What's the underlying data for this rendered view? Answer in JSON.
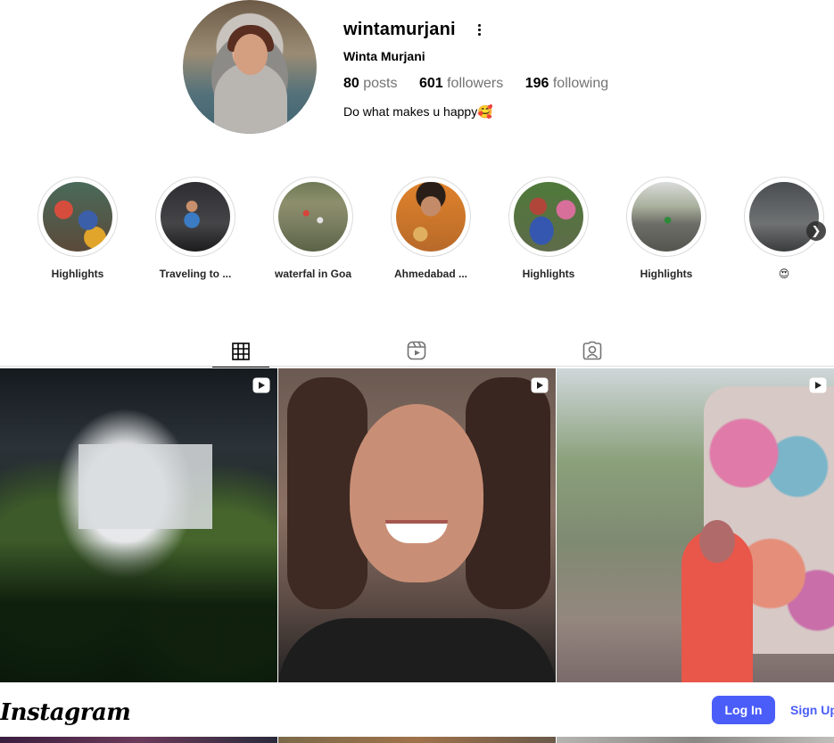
{
  "profile": {
    "username": "wintamurjani",
    "full_name": "Winta Murjani",
    "posts_count": "80",
    "posts_label": "posts",
    "followers_count": "601",
    "followers_label": "followers",
    "following_count": "196",
    "following_label": "following",
    "bio": "Do what makes u happy🥰"
  },
  "highlights": [
    {
      "label": "Highlights"
    },
    {
      "label": "Traveling to ..."
    },
    {
      "label": "waterfal in Goa"
    },
    {
      "label": "Ahmedabad ..."
    },
    {
      "label": "Highlights"
    },
    {
      "label": "Highlights"
    },
    {
      "label": "😍"
    }
  ],
  "tabs": [
    {
      "name": "posts",
      "icon": "grid-icon",
      "active": true
    },
    {
      "name": "reels",
      "icon": "reels-icon",
      "active": false
    },
    {
      "name": "tagged",
      "icon": "tagged-icon",
      "active": false
    }
  ],
  "posts": [
    {
      "type": "reel",
      "icon": "reel-icon"
    },
    {
      "type": "reel",
      "icon": "reel-icon"
    },
    {
      "type": "reel",
      "icon": "reel-icon"
    }
  ],
  "footer": {
    "logo": "Instagram",
    "login_label": "Log In",
    "signup_label": "Sign Up"
  },
  "colors": {
    "accent": "#4a5df9",
    "muted_text": "#737373",
    "border": "#dbdbdb"
  }
}
